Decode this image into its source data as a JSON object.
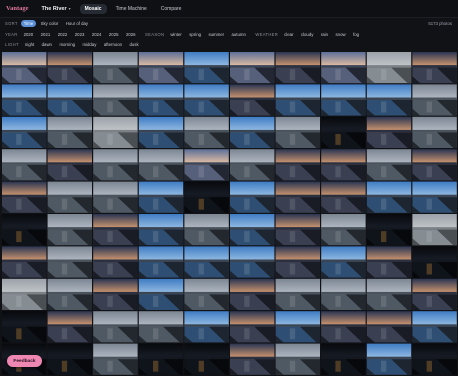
{
  "app": {
    "brand": "Vantage",
    "project": "The River",
    "nav": [
      {
        "label": "Mosaic",
        "active": true
      },
      {
        "label": "Time Machine",
        "active": false
      },
      {
        "label": "Compare",
        "active": false
      }
    ]
  },
  "filters": {
    "sort": {
      "label": "SORT",
      "options": [
        {
          "label": "Time",
          "active": true
        },
        {
          "label": "Sky color",
          "active": false
        },
        {
          "label": "Hour of day",
          "active": false
        }
      ]
    },
    "photo_count": "5173 photos",
    "year": {
      "label": "YEAR",
      "options": [
        "2020",
        "2021",
        "2022",
        "2023",
        "2024",
        "2025",
        "2026"
      ]
    },
    "season": {
      "label": "SEASON",
      "options": [
        "winter",
        "spring",
        "summer",
        "autumn"
      ]
    },
    "weather": {
      "label": "WEATHER",
      "options": [
        "clear",
        "cloudy",
        "rain",
        "snow",
        "fog"
      ]
    },
    "light": {
      "label": "LIGHT",
      "options": [
        "night",
        "dawn",
        "morning",
        "midday",
        "afternoon",
        "dusk"
      ]
    }
  },
  "mosaic": {
    "columns": 10,
    "rows": 10,
    "tile_moods": [
      "dawn",
      "dusk",
      "cloudy",
      "dawn",
      "clear",
      "dawn",
      "dusk",
      "dawn",
      "fog",
      "dusk",
      "clear",
      "clear",
      "cloudy",
      "clear",
      "clear",
      "dusk",
      "clear",
      "clear",
      "clear",
      "cloudy",
      "clear",
      "cloudy",
      "fog",
      "clear",
      "cloudy",
      "clear",
      "cloudy",
      "night",
      "dusk",
      "cloudy",
      "cloudy",
      "dusk",
      "cloudy",
      "cloudy",
      "dawn",
      "cloudy",
      "dusk",
      "dusk",
      "cloudy",
      "dusk",
      "dusk",
      "cloudy",
      "cloudy",
      "clear",
      "night",
      "clear",
      "dusk",
      "dusk",
      "clear",
      "clear",
      "night",
      "cloudy",
      "dusk",
      "clear",
      "cloudy",
      "clear",
      "dusk",
      "cloudy",
      "night",
      "fog",
      "dusk",
      "cloudy",
      "dusk",
      "clear",
      "clear",
      "clear",
      "dusk",
      "clear",
      "dusk",
      "night",
      "fog",
      "cloudy",
      "dusk",
      "clear",
      "cloudy",
      "dusk",
      "cloudy",
      "cloudy",
      "cloudy",
      "dusk",
      "night",
      "dusk",
      "cloudy",
      "cloudy",
      "clear",
      "dusk",
      "clear",
      "dusk",
      "dusk",
      "clear",
      "night",
      "night",
      "cloudy",
      "night",
      "night",
      "dusk",
      "cloudy",
      "night",
      "clear",
      "night"
    ]
  },
  "feedback": {
    "label": "Feedback"
  },
  "colors": {
    "accent": "#5b8fd6",
    "brand": "#e0789a",
    "feedback_bg": "#ee88b3",
    "background": "#111216"
  }
}
